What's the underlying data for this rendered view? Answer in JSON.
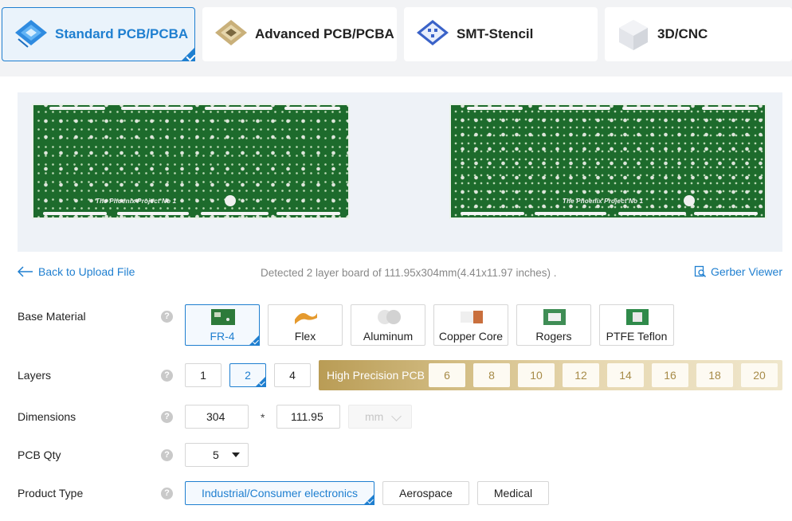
{
  "tabs": [
    {
      "label": "Standard PCB/PCBA",
      "icon": "standard-pcb-icon",
      "active": true
    },
    {
      "label": "Advanced PCB/PCBA",
      "icon": "advanced-pcb-icon",
      "active": false
    },
    {
      "label": "SMT-Stencil",
      "icon": "smt-stencil-icon",
      "active": false
    },
    {
      "label": "3D/CNC",
      "icon": "3d-cnc-icon",
      "active": false
    }
  ],
  "preview": {
    "top_board_text": "The Phoenix Project No 1",
    "bottom_board_text": "The Phoenix Project No 1"
  },
  "nav": {
    "back_label": "Back to Upload File",
    "detected_text": "Detected 2 layer board of 111.95x304mm(4.41x11.97 inches) .",
    "gerber_label": "Gerber Viewer"
  },
  "form": {
    "base_material": {
      "label": "Base Material",
      "help": "?",
      "options": [
        "FR-4",
        "Flex",
        "Aluminum",
        "Copper Core",
        "Rogers",
        "PTFE Teflon"
      ],
      "selected": "FR-4"
    },
    "layers": {
      "label": "Layers",
      "help": "?",
      "options": [
        "1",
        "2",
        "4"
      ],
      "selected": "2",
      "high_precision_label": "High Precision PCB",
      "high_precision_options": [
        "6",
        "8",
        "10",
        "12",
        "14",
        "16",
        "18",
        "20"
      ]
    },
    "dimensions": {
      "label": "Dimensions",
      "help": "?",
      "length": "304",
      "width": "111.95",
      "separator": "*",
      "unit": "mm"
    },
    "pcb_qty": {
      "label": "PCB Qty",
      "help": "?",
      "value": "5"
    },
    "product_type": {
      "label": "Product Type",
      "help": "?",
      "options": [
        "Industrial/Consumer electronics",
        "Aerospace",
        "Medical"
      ],
      "selected": "Industrial/Consumer electronics"
    }
  },
  "colors": {
    "accent": "#1f7fd0",
    "pcb_green": "#1d6b2c",
    "gold": "#b99c55"
  }
}
